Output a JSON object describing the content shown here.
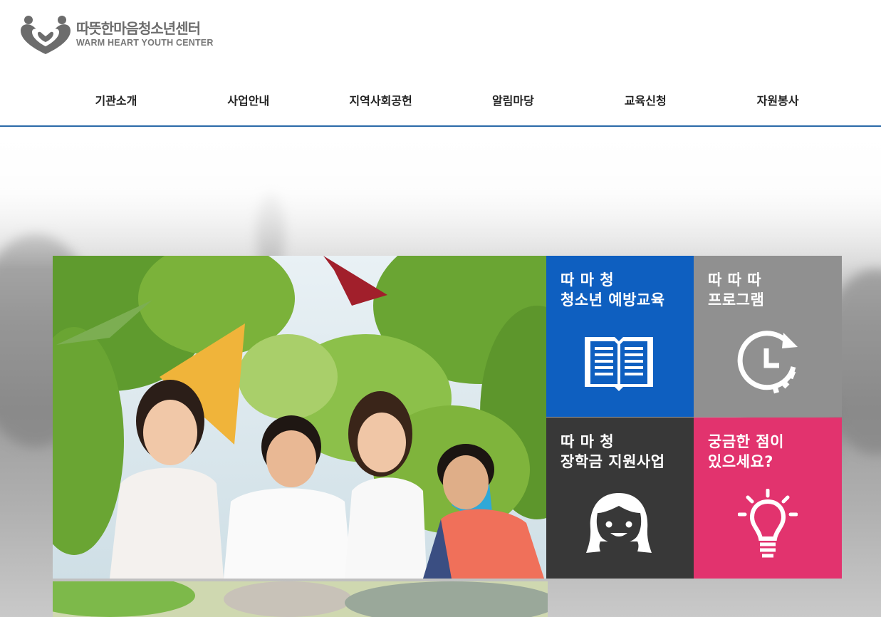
{
  "header": {
    "logo_name_ko": "따뜻한마음청소년센터",
    "logo_name_en": "WARM HEART YOUTH CENTER",
    "nav": [
      {
        "label": "기관소개"
      },
      {
        "label": "사업안내"
      },
      {
        "label": "지역사회공헌"
      },
      {
        "label": "알림마당"
      },
      {
        "label": "교육신청"
      },
      {
        "label": "자원봉사"
      }
    ]
  },
  "tiles": [
    {
      "line1": "따 마 청",
      "line2": "청소년 예방교육",
      "icon": "book-icon",
      "color": "#0e5fc0"
    },
    {
      "line1": "따 따 따",
      "line2": "프로그램",
      "icon": "clock-icon",
      "color": "#909090"
    },
    {
      "line1": "따 마 청",
      "line2": "장학금 지원사업",
      "icon": "girl-face-icon",
      "color": "#383838"
    },
    {
      "line1": "궁금한 점이",
      "line2": "있으세요?",
      "icon": "lightbulb-icon",
      "color": "#e2336e"
    }
  ],
  "colors": {
    "nav_border": "#2b6aa8",
    "logo_gray": "#6c6c6c"
  }
}
